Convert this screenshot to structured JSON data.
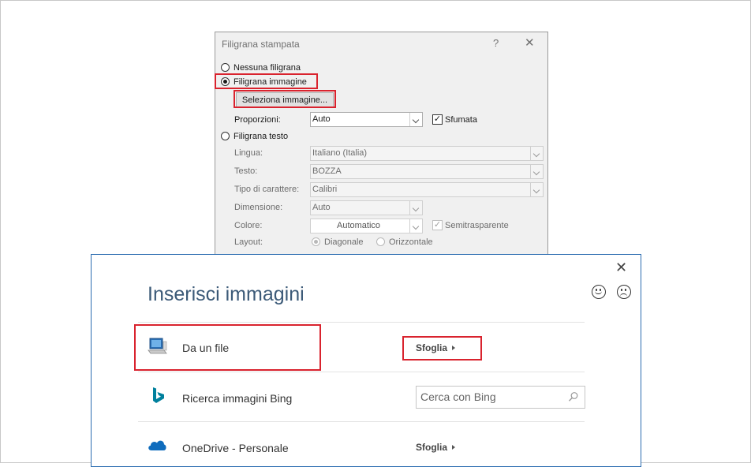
{
  "watermark_dialog": {
    "title": "Filigrana stampata",
    "help": "?",
    "close": "✕",
    "options": {
      "none": "Nessuna filigrana",
      "picture": "Filigrana immagine",
      "text": "Filigrana testo"
    },
    "selected_option": "picture",
    "select_picture_button": "Seleziona immagine...",
    "scale": {
      "label": "Proporzioni:",
      "value": "Auto"
    },
    "washout": {
      "label": "Sfumata",
      "checked": true
    },
    "text_fields": {
      "language": {
        "label": "Lingua:",
        "value": "Italiano (Italia)"
      },
      "text": {
        "label": "Testo:",
        "value": "BOZZA"
      },
      "font": {
        "label": "Tipo di carattere:",
        "value": "Calibri"
      },
      "size": {
        "label": "Dimensione:",
        "value": "Auto"
      },
      "color": {
        "label": "Colore:",
        "value": "Automatico"
      },
      "semitransparent": {
        "label": "Semitrasparente",
        "checked": true
      },
      "layout": {
        "label": "Layout:",
        "diagonal": "Diagonale",
        "horizontal": "Orizzontale",
        "selected": "diagonal"
      }
    }
  },
  "insert_pictures_dialog": {
    "title": "Inserisci immagini",
    "close": "✕",
    "rows": [
      {
        "icon": "computer-icon",
        "label": "Da un file",
        "action": "Sfoglia"
      },
      {
        "icon": "bing-icon",
        "label": "Ricerca immagini Bing",
        "search_placeholder": "Cerca con Bing"
      },
      {
        "icon": "onedrive-icon",
        "label": "OneDrive - Personale",
        "action": "Sfoglia"
      }
    ]
  },
  "colors": {
    "highlight": "#d9232e",
    "dialog_border": "#2b6cb0",
    "title_text": "#3c5a78",
    "bing": "#00809d",
    "onedrive": "#0f6cbd"
  }
}
